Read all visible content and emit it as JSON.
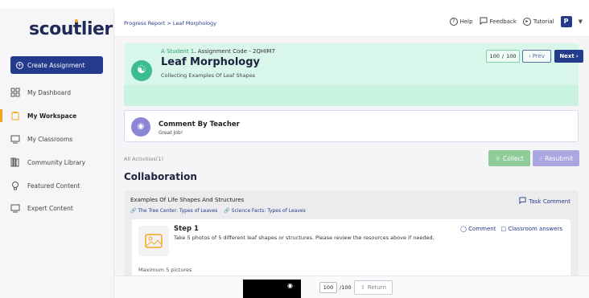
{
  "app": {
    "logo": "scoutlier"
  },
  "sidebar": {
    "create_button": "Create Assignment",
    "items": [
      {
        "label": "My Dashboard",
        "icon": "dashboard-icon"
      },
      {
        "label": "My Workspace",
        "icon": "clipboard-icon",
        "active": true
      },
      {
        "label": "My Classrooms",
        "icon": "classroom-icon"
      },
      {
        "label": "Community Library",
        "icon": "library-icon"
      },
      {
        "label": "Featured Content",
        "icon": "bulb-icon"
      },
      {
        "label": "Expert Content",
        "icon": "expert-icon"
      }
    ]
  },
  "header": {
    "breadcrumb": "Progress Report > Leaf Morphology",
    "help": "Help",
    "feedback": "Feedback",
    "tutorial": "Tutorial",
    "avatar_letter": "P"
  },
  "banner": {
    "student": "A Student 1",
    "assignment_code": ". Assignment Code - 2QHIM7",
    "title": "Leaf Morphology",
    "subtitle": "Collecting Examples Of Leaf Shapes",
    "score": "100",
    "score_total": "100",
    "prev_label": "Prev",
    "next_label": "Next"
  },
  "comment": {
    "title": "Comment By Teacher",
    "text": "Great Job!"
  },
  "activities": {
    "label": "All Activities(1)",
    "collect_label": "Collect",
    "resubmit_label": "Resubmit",
    "section_title": "Collaboration"
  },
  "task": {
    "title": "Examples Of Life Shapes And Structures",
    "comment_label": "Task Comment",
    "links": [
      "The Tree Center: Types of Leaves",
      "Science Facts: Types of Leaves"
    ]
  },
  "step": {
    "title": "Step 1",
    "description": "Take 5 photos of 5 different leaf shapes or structures. Please review the resources above if needed.",
    "comment_label": "Comment",
    "classroom_answers_label": "Classroom answers",
    "max_label": "Maximum 5 pictures"
  },
  "bottom": {
    "score": "100",
    "score_total": "/100",
    "return_label": "Return"
  },
  "colors": {
    "brand_navy": "#243a8c",
    "accent_orange": "#f3a61c",
    "banner_green": "#d8f6ea",
    "collect_green": "#8fcc9a",
    "resubmit_purple": "#a9a6e0"
  }
}
